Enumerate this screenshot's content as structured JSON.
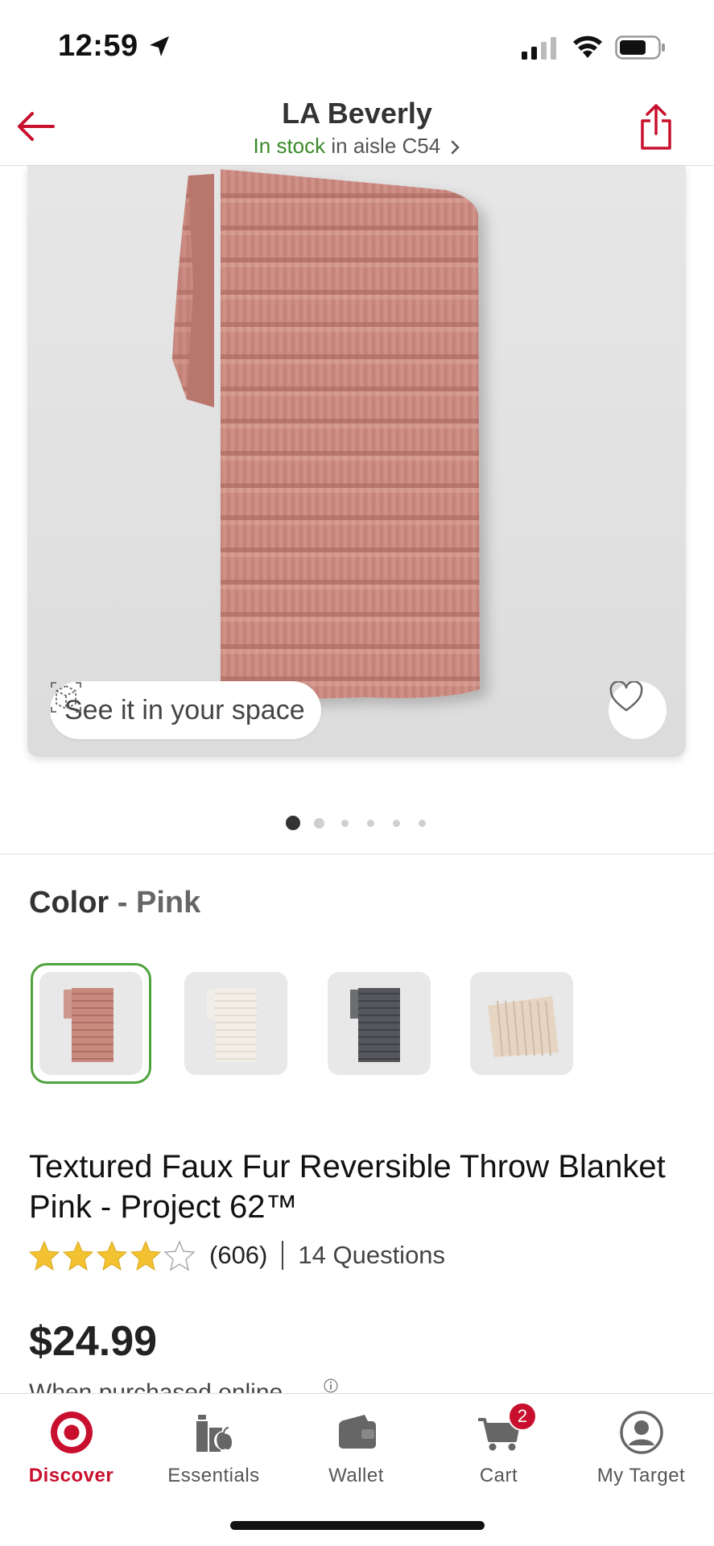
{
  "status": {
    "time": "12:59"
  },
  "header": {
    "store_name": "LA Beverly",
    "stock_status": "In stock",
    "stock_location": "in aisle C54"
  },
  "hero": {
    "see_in_space_label": "See it in your space",
    "image_count": 6,
    "current_image": 1
  },
  "product": {
    "color_label": "Color",
    "color_separator": " - ",
    "color_value": "Pink",
    "swatches": [
      {
        "name": "Pink",
        "color": "#c98a7e",
        "selected": true
      },
      {
        "name": "Cream",
        "color": "#f2eee6",
        "selected": false
      },
      {
        "name": "Charcoal",
        "color": "#55575c",
        "selected": false
      },
      {
        "name": "Beige",
        "color": "#e6d5c3",
        "selected": false
      }
    ],
    "title_line1": "Textured Faux Fur Reversible Throw Blanket",
    "title_line2": "Pink - Project 62™",
    "rating": 4,
    "rating_max": 5,
    "review_count": "(606)",
    "questions": "14 Questions",
    "price": "$24.99",
    "price_note": "When purchased online"
  },
  "tabbar": {
    "tabs": [
      {
        "label": "Discover",
        "active": true
      },
      {
        "label": "Essentials",
        "active": false
      },
      {
        "label": "Wallet",
        "active": false
      },
      {
        "label": "Cart",
        "active": false,
        "badge": "2"
      },
      {
        "label": "My Target",
        "active": false
      }
    ]
  },
  "colors": {
    "brand_red": "#c8102e",
    "stock_green": "#3a8a2a",
    "selected_swatch_border": "#4fa33d",
    "star_gold": "#f2c230"
  }
}
